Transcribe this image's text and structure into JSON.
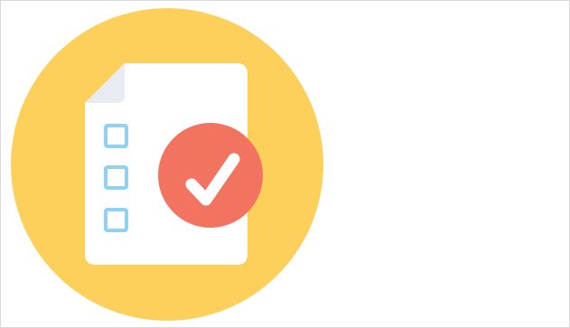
{
  "illustration": {
    "icon": "checklist-document-approved-icon",
    "colors": {
      "background_circle": "#FDD05C",
      "document": "#FFFFFF",
      "document_fold": "#E9EBF2",
      "checkbox": "#8ED3F2",
      "check_badge": "#F27360",
      "checkmark": "#FFFFFF",
      "frame_border": "#D9D9D9"
    },
    "checklist_items": [
      {
        "checked": false
      },
      {
        "checked": false
      },
      {
        "checked": false
      }
    ],
    "approval_badge": {
      "checked": true
    }
  }
}
